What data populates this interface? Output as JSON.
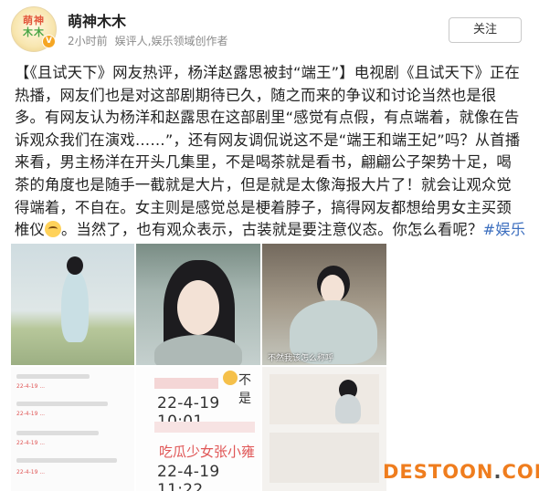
{
  "author": {
    "avatar_text_top": "萌神",
    "avatar_text_mid": "木木",
    "avatar_badge": "V",
    "name": "萌神木木",
    "time": "2小时前",
    "role": "娱评人,娱乐领域创作者"
  },
  "follow_button": "关注",
  "post": {
    "text": "【《且试天下》网友热评，杨洋赵露思被封“端王”】电视剧《且试天下》正在热播，网友们也是对这部剧期待已久，随之而来的争议和讨论当然也是很多。有网友认为杨洋和赵露思在这部剧里“感觉有点假，有点端着，就像在告诉观众我们在演戏……”，还有网友调侃说这不是“端王和端王妃”吗？从首播来看，男主杨洋在开头几集里，不是喝茶就是看书，翩翩公子架势十足，喝茶的角度也是随手一截就是大片，但是就是太像海报大片了！就会让观众觉得端着，不自在。女主则是感觉总是梗着脖子，搞得网友都想给男女主买颈椎仪",
    "text_after_emoji": "。当然了，也有观众表示，古装就是要注意仪态。你怎么看呢？",
    "hashtag": "#娱乐八卦播报台#"
  },
  "images": {
    "tile3_caption": "不然我该怎么称呼",
    "tile5_snippet_1": "不是",
    "tile5_time_1": "22-4-19 10:01",
    "tile5_name": "吃瓜少女张小雍",
    "tile5_time_2": "22-4-19 11:22",
    "tile4_lines": [
      "22-4-19 ...",
      "22-4-19 ...",
      "22-4-19 ...",
      "22-4-19 ..."
    ]
  },
  "watermark": {
    "brand": "DESTOON",
    "dot": ".",
    "tld": "COM"
  }
}
